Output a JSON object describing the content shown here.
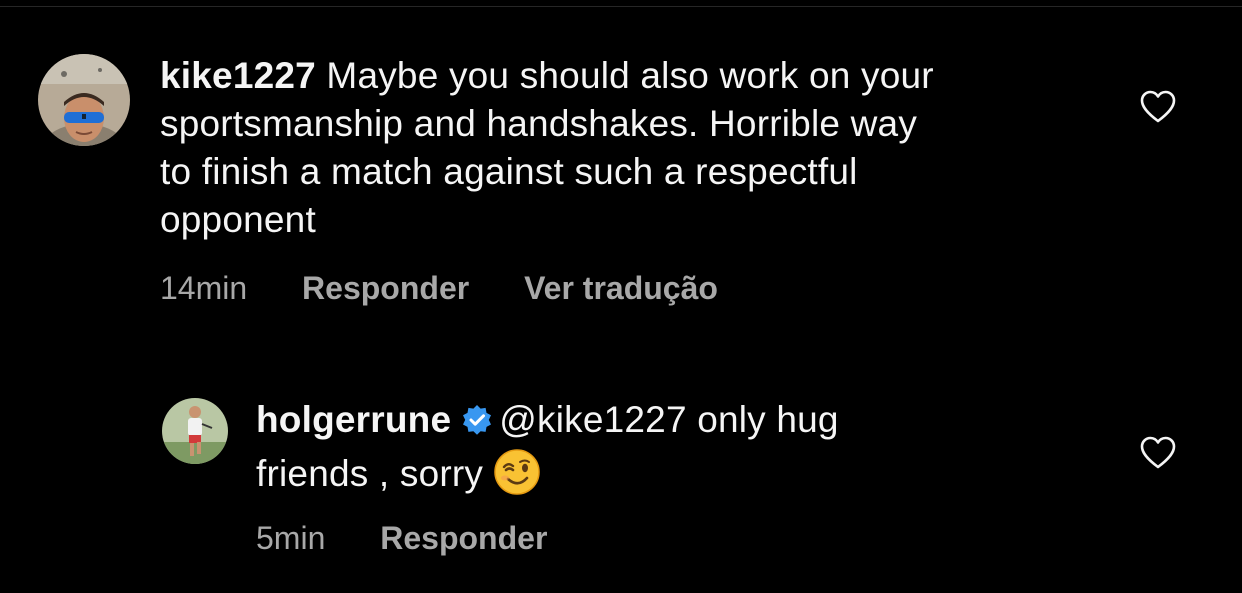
{
  "comments": [
    {
      "username": "kike1227",
      "text": "Maybe you should also work on your sportsmanship and handshakes. Horrible way to finish a match against such a respectful opponent",
      "lines": [
        "Maybe you should also work on your",
        "sportsmanship and handshakes. Horrible way",
        "to finish a match against such a respectful",
        "opponent"
      ],
      "time": "14min",
      "reply_label": "Responder",
      "translate_label": "Ver tradução",
      "avatar_icon": "profile-photo-sunglasses",
      "like_icon": "heart-outline-icon"
    },
    {
      "username": "holgerrune",
      "verified": true,
      "mention": "@kike1227",
      "line1_rest": "only hug",
      "line2": "friends , sorry",
      "emoji": "winking-face",
      "time": "5min",
      "reply_label": "Responder",
      "avatar_icon": "profile-photo-tennis-player",
      "like_icon": "heart-outline-icon"
    }
  ],
  "colors": {
    "background": "#000000",
    "text": "#f5f5f5",
    "meta": "#a8a8a8",
    "verified": "#3897f0"
  }
}
